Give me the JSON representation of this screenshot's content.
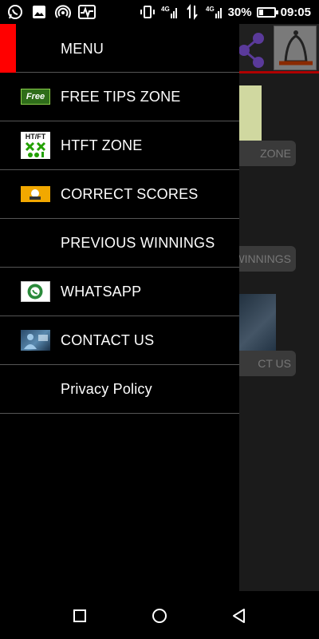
{
  "status_bar": {
    "left_icons": [
      "whatsapp-icon",
      "image-icon",
      "hotspot-icon",
      "activity-icon"
    ],
    "right_icons": [
      "vibrate-icon",
      "signal-4g-icon",
      "data-arrows-icon",
      "signal-bars-icon",
      "battery-icon"
    ],
    "battery_percent": "30%",
    "battery_level": 0.3,
    "time": "09:05"
  },
  "drawer": {
    "header_title": "MENU",
    "accent_color": "#ff0000",
    "items": [
      {
        "label": "FREE TIPS ZONE",
        "icon": "free-badge-icon",
        "icon_text": "Free"
      },
      {
        "label": "HTFT ZONE",
        "icon": "htft-icon",
        "icon_text": "HT/FT"
      },
      {
        "label": "CORRECT SCORES",
        "icon": "correct-scores-icon"
      },
      {
        "label": "PREVIOUS WINNINGS",
        "icon": null
      },
      {
        "label": "WHATSAPP",
        "icon": "whatsapp-logo-icon"
      },
      {
        "label": "CONTACT US",
        "icon": "contact-image-icon"
      },
      {
        "label": "Privacy Policy",
        "icon": null
      }
    ]
  },
  "background_app": {
    "buttons": [
      "ZONE",
      "WINNINGS",
      "CT US"
    ],
    "toolbar_icons": [
      "share-icon",
      "bell-icon"
    ],
    "divider_color": "#b00000"
  },
  "nav_bar": {
    "buttons": [
      "recents-icon",
      "home-icon",
      "back-icon"
    ]
  }
}
